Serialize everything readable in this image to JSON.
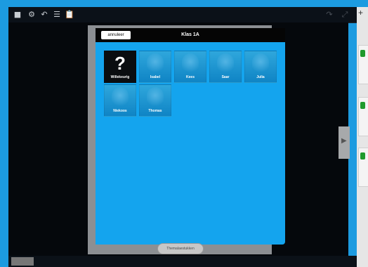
{
  "toolbar": {
    "icons": [
      "square-icon",
      "settings-icon",
      "undo-icon",
      "list-icon",
      "clipboard-icon"
    ]
  },
  "dialog": {
    "cancel_label": "annuleer",
    "title": "Klas 1A",
    "tiles": [
      {
        "name": "Willekeurig",
        "kind": "question-mark"
      },
      {
        "name": "Isabel",
        "kind": "photo"
      },
      {
        "name": "Kees",
        "kind": "photo"
      },
      {
        "name": "Saar",
        "kind": "photo"
      },
      {
        "name": "Julia",
        "kind": "photo"
      },
      {
        "name": "Niekoos",
        "kind": "photo"
      },
      {
        "name": "Thomas",
        "kind": "photo"
      }
    ],
    "question_mark_glyph": "?"
  },
  "footer": {
    "pill_label": "Themalaestukken"
  },
  "sidebar": {
    "add_glyph": "+"
  },
  "colors": {
    "frame": "#1c9be0",
    "panel_blue": "#14a4ee",
    "dark": "#050505"
  }
}
